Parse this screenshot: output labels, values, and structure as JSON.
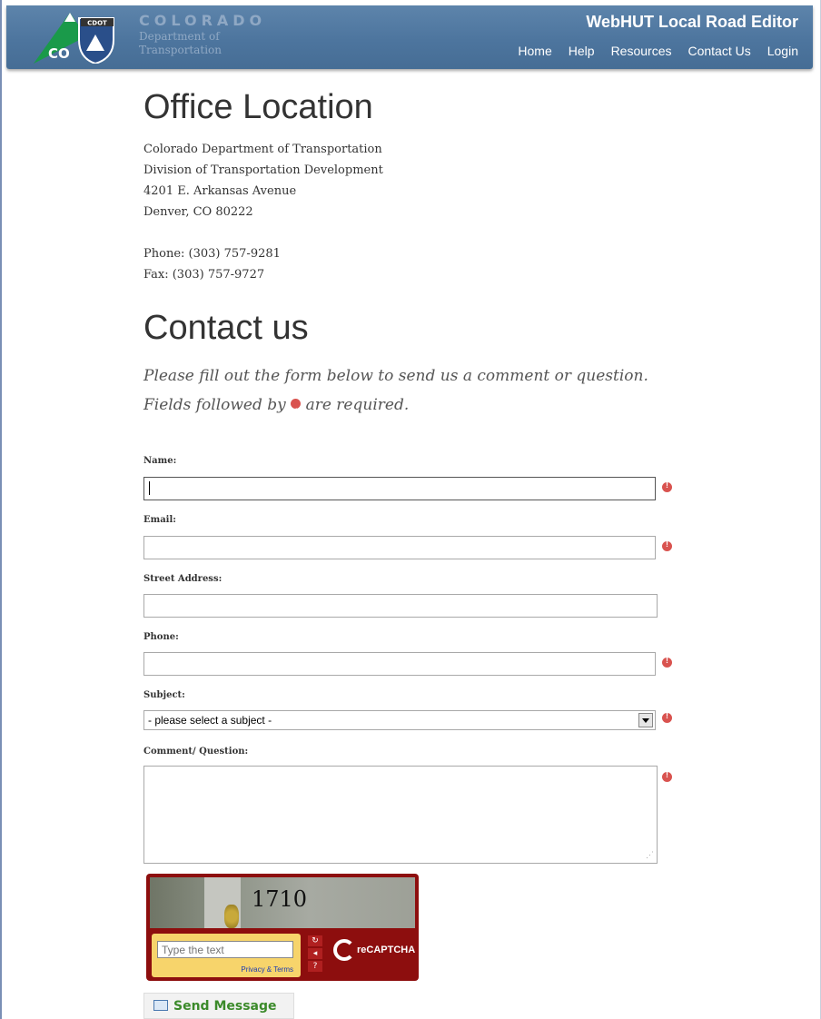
{
  "header": {
    "logo_top": "CDOT",
    "logo_bottom": "CO",
    "brand_title": "COLORADO",
    "brand_sub_1": "Department of",
    "brand_sub_2": "Transportation",
    "app_title": "WebHUT Local Road Editor",
    "nav": [
      "Home",
      "Help",
      "Resources",
      "Contact Us",
      "Login"
    ]
  },
  "office": {
    "heading": "Office Location",
    "lines": [
      "Colorado Department of Transportation",
      "Division of Transportation Development",
      "4201 E. Arkansas Avenue",
      "Denver, CO 80222"
    ],
    "phone": "Phone: (303) 757-9281",
    "fax": "Fax: (303) 757-9727"
  },
  "contact": {
    "heading": "Contact us",
    "intro": "Please fill out the form below to send us a comment or question.",
    "required_prefix": "Fields followed by",
    "required_suffix": "are required."
  },
  "form": {
    "name_label": "Name:",
    "name_value": "",
    "email_label": "Email:",
    "email_value": "",
    "street_label": "Street Address:",
    "street_value": "",
    "phone_label": "Phone:",
    "phone_value": "",
    "subject_label": "Subject:",
    "subject_selected": "- please select a subject -",
    "comment_label": "Comment/ Question:",
    "comment_value": ""
  },
  "captcha": {
    "image_text": "1710",
    "placeholder": "Type the text",
    "privacy_link": "Privacy & Terms",
    "brand": "reCAPTCHA"
  },
  "send_label": "Send Message",
  "colors": {
    "header_blue": "#4d759e",
    "required_red": "#d9534f",
    "captcha_red": "#8d0e0e",
    "send_green": "#3b8a2a"
  }
}
